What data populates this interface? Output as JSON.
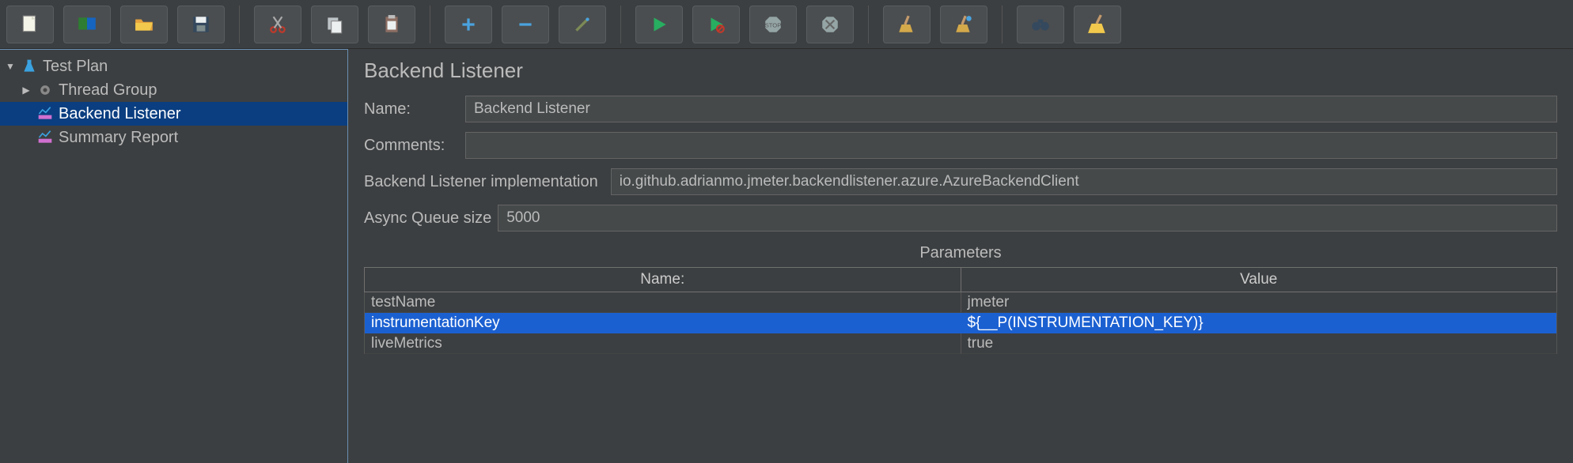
{
  "toolbar": {
    "icons": [
      "new-file",
      "templates",
      "open",
      "save",
      "cut",
      "copy",
      "paste",
      "add",
      "remove",
      "edit",
      "start",
      "start-no-pause",
      "stop",
      "shutdown",
      "clear",
      "clear-all",
      "find",
      "broom"
    ]
  },
  "tree": {
    "root": {
      "label": "Test Plan"
    },
    "threadGroup": {
      "label": "Thread Group"
    },
    "backendListener": {
      "label": "Backend Listener"
    },
    "summaryReport": {
      "label": "Summary Report"
    }
  },
  "panel": {
    "title": "Backend Listener",
    "name_label": "Name:",
    "name_value": "Backend Listener",
    "comments_label": "Comments:",
    "comments_value": "",
    "impl_label": "Backend Listener implementation",
    "impl_value": "io.github.adrianmo.jmeter.backendlistener.azure.AzureBackendClient",
    "queue_label": "Async Queue size",
    "queue_value": "5000"
  },
  "parameters": {
    "section_title": "Parameters",
    "header_name": "Name:",
    "header_value": "Value",
    "rows": [
      {
        "name": "testName",
        "value": "jmeter",
        "selected": false
      },
      {
        "name": "instrumentationKey",
        "value": "${__P(INSTRUMENTATION_KEY)}",
        "selected": true
      },
      {
        "name": "liveMetrics",
        "value": "true",
        "selected": false
      }
    ]
  }
}
